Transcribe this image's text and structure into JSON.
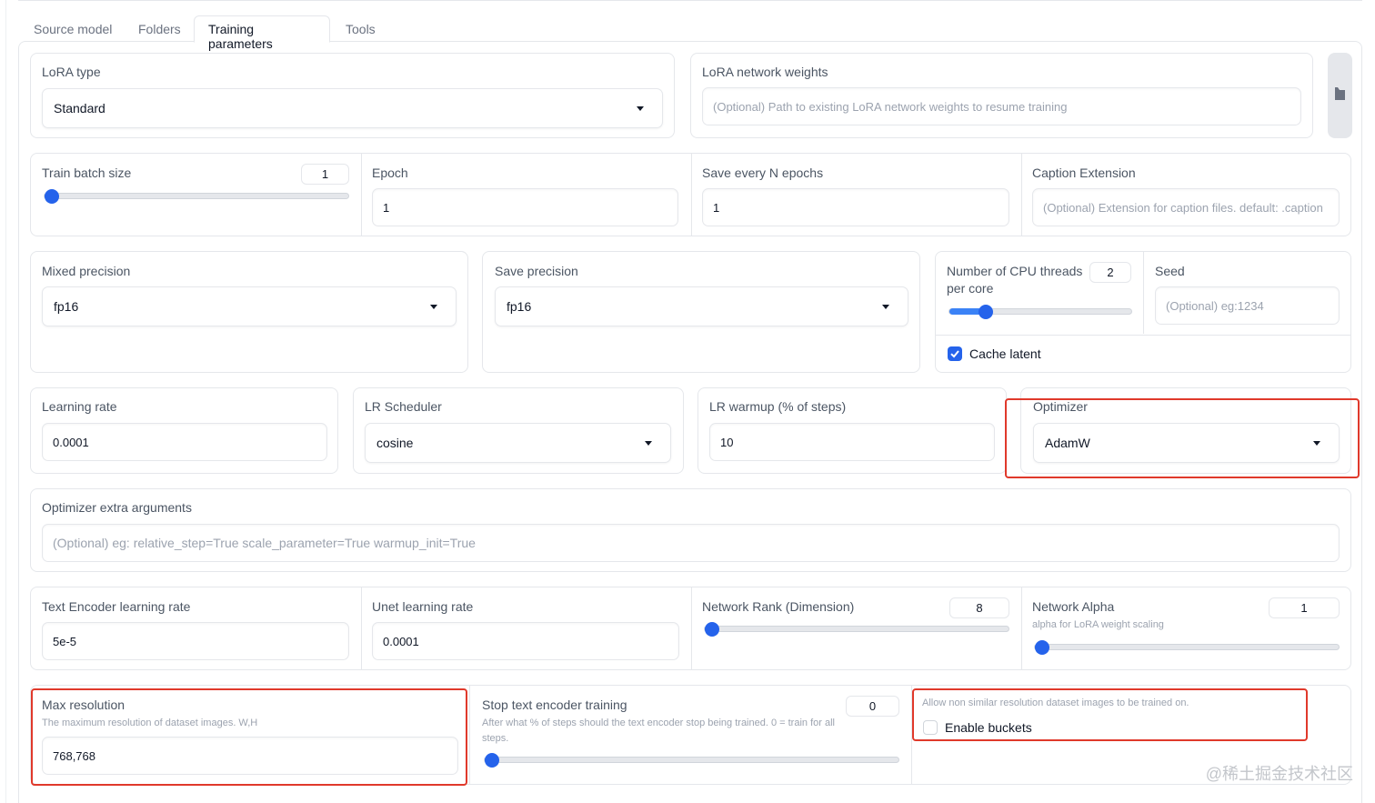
{
  "tabs": [
    "Source model",
    "Folders",
    "Training parameters",
    "Tools"
  ],
  "active_tab": "Training parameters",
  "lora_type": {
    "label": "LoRA type",
    "value": "Standard"
  },
  "lora_network_weights": {
    "label": "LoRA network weights",
    "placeholder": "(Optional) Path to existing LoRA network weights to resume training"
  },
  "train_batch_size": {
    "label": "Train batch size",
    "value": "1",
    "fraction": 0.0
  },
  "epoch": {
    "label": "Epoch",
    "value": "1"
  },
  "save_every_n_epochs": {
    "label": "Save every N epochs",
    "value": "1"
  },
  "caption_extension": {
    "label": "Caption Extension",
    "placeholder": "(Optional) Extension for caption files. default: .caption"
  },
  "mixed_precision": {
    "label": "Mixed precision",
    "value": "fp16"
  },
  "save_precision": {
    "label": "Save precision",
    "value": "fp16"
  },
  "cpu_threads": {
    "label_line1": "Number of CPU threads",
    "label_line2": "per core",
    "value": "2",
    "fraction": 0.17
  },
  "seed": {
    "label": "Seed",
    "placeholder": "(Optional) eg:1234"
  },
  "cache_latent": {
    "label": "Cache latent",
    "checked": true
  },
  "learning_rate": {
    "label": "Learning rate",
    "value": "0.0001"
  },
  "lr_scheduler": {
    "label": "LR Scheduler",
    "value": "cosine"
  },
  "lr_warmup": {
    "label": "LR warmup (% of steps)",
    "value": "10"
  },
  "optimizer": {
    "label": "Optimizer",
    "value": "AdamW"
  },
  "optimizer_extra_args": {
    "label": "Optimizer extra arguments",
    "placeholder": "(Optional) eg: relative_step=True scale_parameter=True warmup_init=True"
  },
  "text_encoder_lr": {
    "label": "Text Encoder learning rate",
    "value": "5e-5"
  },
  "unet_lr": {
    "label": "Unet learning rate",
    "value": "0.0001"
  },
  "network_rank": {
    "label": "Network Rank (Dimension)",
    "value": "8",
    "fraction": 0.0
  },
  "network_alpha": {
    "label": "Network Alpha",
    "info": "alpha for LoRA weight scaling",
    "value": "1",
    "fraction": 0.0
  },
  "max_resolution": {
    "label": "Max resolution",
    "info": "The maximum resolution of dataset images. W,H",
    "value": "768,768"
  },
  "stop_text_encoder": {
    "label": "Stop text encoder training",
    "info_line1": "After what % of steps should the text encoder stop being trained. 0 = train for all",
    "info_line2": "steps.",
    "value": "0",
    "fraction": 0.0
  },
  "enable_buckets": {
    "info": "Allow non similar resolution dataset images to be trained on.",
    "label": "Enable buckets",
    "checked": false
  },
  "watermark": "@稀土掘金技术社区",
  "colors": {
    "accent": "#2563eb",
    "highlight": "#e0392b",
    "border": "#e5e7eb"
  }
}
